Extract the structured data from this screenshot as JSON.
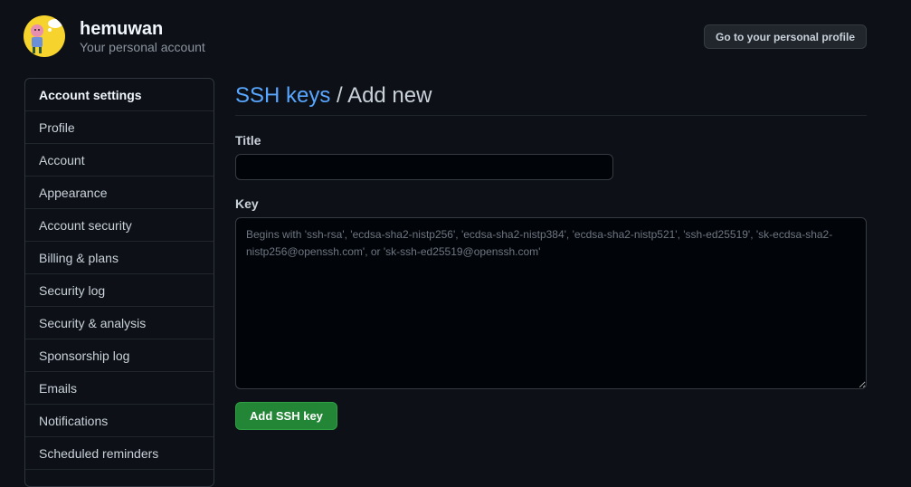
{
  "header": {
    "username": "hemuwan",
    "subtitle": "Your personal account",
    "profile_button": "Go to your personal profile"
  },
  "sidebar": {
    "heading": "Account settings",
    "items": [
      {
        "label": "Profile"
      },
      {
        "label": "Account"
      },
      {
        "label": "Appearance"
      },
      {
        "label": "Account security"
      },
      {
        "label": "Billing & plans"
      },
      {
        "label": "Security log"
      },
      {
        "label": "Security & analysis"
      },
      {
        "label": "Sponsorship log"
      },
      {
        "label": "Emails"
      },
      {
        "label": "Notifications"
      },
      {
        "label": "Scheduled reminders"
      }
    ]
  },
  "main": {
    "breadcrumb_link": "SSH keys",
    "breadcrumb_separator": " / ",
    "breadcrumb_current": "Add new",
    "title_label": "Title",
    "title_value": "",
    "key_label": "Key",
    "key_placeholder": "Begins with 'ssh-rsa', 'ecdsa-sha2-nistp256', 'ecdsa-sha2-nistp384', 'ecdsa-sha2-nistp521', 'ssh-ed25519', 'sk-ecdsa-sha2-nistp256@openssh.com', or 'sk-ssh-ed25519@openssh.com'",
    "submit_label": "Add SSH key"
  },
  "colors": {
    "background": "#0d1117",
    "link": "#58a6ff",
    "primary_button": "#238636",
    "avatar_bg": "#f6d32d"
  }
}
